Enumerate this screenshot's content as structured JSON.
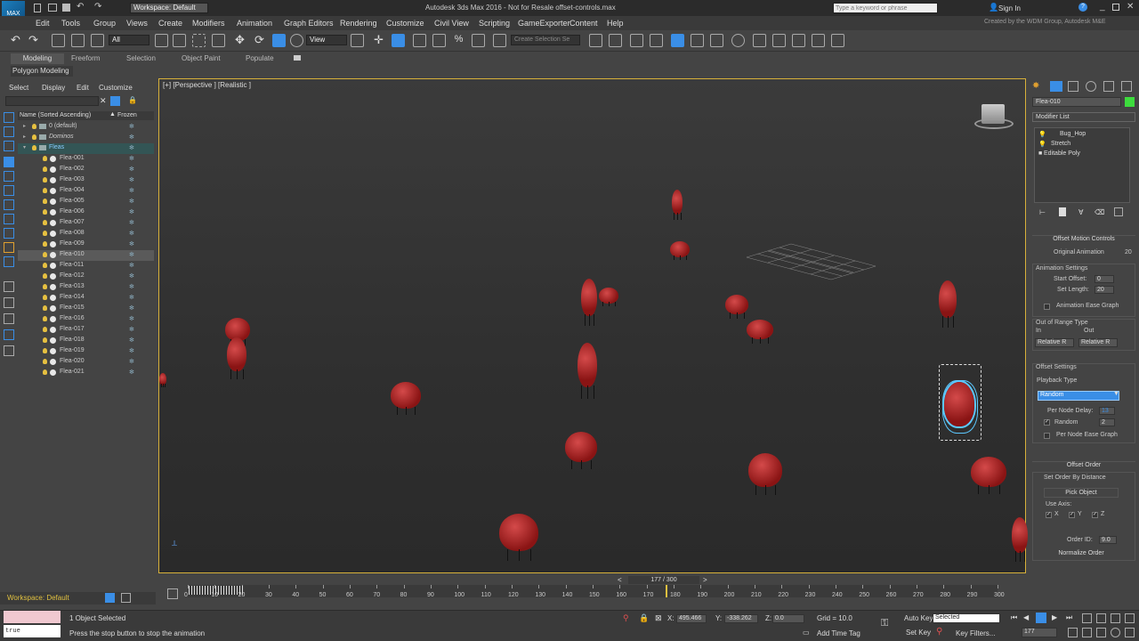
{
  "titlebar": {
    "workspace": "Workspace: Default",
    "title": "Autodesk 3ds Max 2016 - Not for Resale   offset-controls.max",
    "search_placeholder": "Type a keyword or phrase",
    "sign_in": "Sign In",
    "credit": "Created by the WDM Group, Autodesk M&E"
  },
  "menus": [
    "Edit",
    "Tools",
    "Group",
    "Views",
    "Create",
    "Modifiers",
    "Animation",
    "Graph Editors",
    "Rendering",
    "Customize",
    "Civil View",
    "Scripting",
    "GameExporter",
    "Content",
    "Help"
  ],
  "toolbar": {
    "filter_value": "All",
    "ref_coord": "View",
    "selection_set_placeholder": "Create Selection Se"
  },
  "ribbon": {
    "tabs": [
      "Modeling",
      "Freeform",
      "Selection",
      "Object Paint",
      "Populate"
    ],
    "active_tab": "Modeling",
    "sub_label": "Polygon Modeling"
  },
  "explorer": {
    "menu": [
      "Select",
      "Display",
      "Edit",
      "Customize"
    ],
    "col_name": "Name (Sorted Ascending)",
    "col_frozen": "Frozen",
    "rows": [
      {
        "name": "0 (default)",
        "level": 1,
        "type": "layer"
      },
      {
        "name": "Dominos",
        "level": 1,
        "type": "layer"
      },
      {
        "name": "Fleas",
        "level": 1,
        "type": "layer-active"
      },
      {
        "name": "Flea-001",
        "level": 2,
        "type": "obj"
      },
      {
        "name": "Flea-002",
        "level": 2,
        "type": "obj"
      },
      {
        "name": "Flea-003",
        "level": 2,
        "type": "obj"
      },
      {
        "name": "Flea-004",
        "level": 2,
        "type": "obj"
      },
      {
        "name": "Flea-005",
        "level": 2,
        "type": "obj"
      },
      {
        "name": "Flea-006",
        "level": 2,
        "type": "obj"
      },
      {
        "name": "Flea-007",
        "level": 2,
        "type": "obj"
      },
      {
        "name": "Flea-008",
        "level": 2,
        "type": "obj"
      },
      {
        "name": "Flea-009",
        "level": 2,
        "type": "obj"
      },
      {
        "name": "Flea-010",
        "level": 2,
        "type": "obj-selected"
      },
      {
        "name": "Flea-011",
        "level": 2,
        "type": "obj"
      },
      {
        "name": "Flea-012",
        "level": 2,
        "type": "obj"
      },
      {
        "name": "Flea-013",
        "level": 2,
        "type": "obj"
      },
      {
        "name": "Flea-014",
        "level": 2,
        "type": "obj"
      },
      {
        "name": "Flea-015",
        "level": 2,
        "type": "obj"
      },
      {
        "name": "Flea-016",
        "level": 2,
        "type": "obj"
      },
      {
        "name": "Flea-017",
        "level": 2,
        "type": "obj"
      },
      {
        "name": "Flea-018",
        "level": 2,
        "type": "obj"
      },
      {
        "name": "Flea-019",
        "level": 2,
        "type": "obj"
      },
      {
        "name": "Flea-020",
        "level": 2,
        "type": "obj"
      },
      {
        "name": "Flea-021",
        "level": 2,
        "type": "obj"
      }
    ],
    "workspace": "Workspace: Default"
  },
  "viewport": {
    "label": "[+] [Perspective ] [Realistic ]"
  },
  "command_panel": {
    "object_name": "Flea-010",
    "modifier_list": "Modifier List",
    "stack": [
      "Bug_Hop",
      "Stretch",
      "Editable Poly"
    ],
    "rollout_title": "Offset Motion Controls",
    "original_animation_label": "Original Animation",
    "original_animation_value": "20",
    "animation_settings": "Animation Settings",
    "start_offset_label": "Start Offset:",
    "start_offset_value": "0",
    "set_length_label": "Set Length:",
    "set_length_value": "20",
    "anim_ease_graph": "Animation Ease Graph",
    "out_of_range": "Out of Range Type",
    "in_label": "In",
    "out_label": "Out",
    "in_value": "Relative R",
    "out_value": "Relative R",
    "offset_settings": "Offset Settings",
    "playback_type_label": "Playback Type",
    "playback_type_value": "Random",
    "per_node_delay_label": "Per Node Delay:",
    "per_node_delay_value": "13",
    "random_label": "Random",
    "random_value": "2",
    "per_node_ease": "Per Node Ease Graph",
    "offset_order": "Offset Order",
    "set_order_by_distance": "Set Order By Distance",
    "pick_object": "Pick Object",
    "use_axis": "Use Axis:",
    "axes": [
      "X",
      "Y",
      "Z"
    ],
    "order_id_label": "Order ID:",
    "order_id_value": "9.0",
    "normalize_order": "Normalize Order"
  },
  "timeline": {
    "frame_display": "177 / 300",
    "current_frame": 177,
    "ticks": [
      0,
      10,
      20,
      30,
      40,
      50,
      60,
      70,
      80,
      90,
      100,
      110,
      120,
      130,
      140,
      150,
      160,
      170,
      180,
      190,
      200,
      210,
      220,
      230,
      240,
      250,
      260,
      270,
      280,
      290,
      300
    ]
  },
  "status": {
    "script_field": "true",
    "selected": "1 Object Selected",
    "prompt": "Press the stop button to stop the animation",
    "x_value": "495.466",
    "y_value": "-338.262",
    "z_value": "0.0",
    "grid": "Grid = 10.0",
    "add_time_tag": "Add Time Tag",
    "auto_key": "Auto Key",
    "selected_dropdown": "Selected",
    "set_key": "Set Key",
    "key_filters": "Key Filters...",
    "frame_field": "177"
  },
  "colors": {
    "accent_blue": "#3a8ee6",
    "flea_red": "#b22222",
    "viewport_border": "#d8b13a",
    "selection_cyan": "#5cc8ff"
  }
}
